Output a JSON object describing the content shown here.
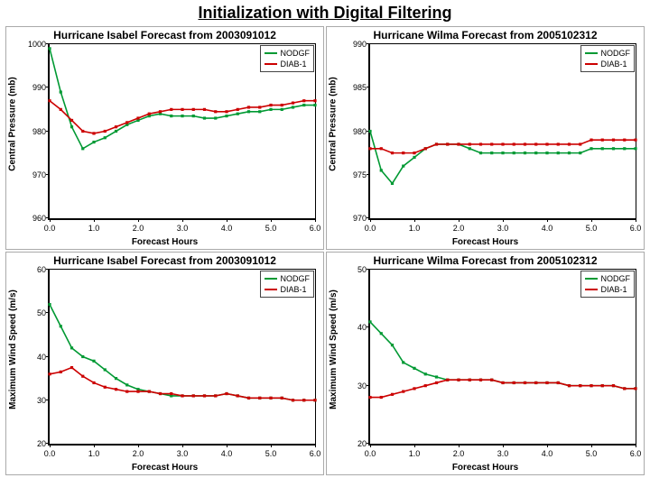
{
  "page_title": "Initialization with Digital Filtering",
  "colors": {
    "nodgf": "#009933",
    "diab1": "#cc0000"
  },
  "legend": {
    "s1": "NODGF",
    "s2": "DIAB-1"
  },
  "charts": [
    {
      "title": "Hurricane Isabel Forecast from 2003091012",
      "xlabel": "Forecast Hours",
      "ylabel": "Central Pressure (mb)"
    },
    {
      "title": "Hurricane Wilma Forecast from 2005102312",
      "xlabel": "Forecast Hours",
      "ylabel": "Central Pressure (mb)"
    },
    {
      "title": "Hurricane Isabel Forecast from 2003091012",
      "xlabel": "Forecast Hours",
      "ylabel": "Maximum Wind Speed (m/s)"
    },
    {
      "title": "Hurricane Wilma Forecast from 2005102312",
      "xlabel": "Forecast Hours",
      "ylabel": "Maximum Wind Speed (m/s)"
    }
  ],
  "chart_data": [
    {
      "type": "line",
      "title": "Hurricane Isabel Forecast from 2003091012",
      "xlabel": "Forecast Hours",
      "ylabel": "Central Pressure (mb)",
      "xlim": [
        0,
        6
      ],
      "ylim": [
        960,
        1000
      ],
      "xticks": [
        0,
        1,
        2,
        3,
        4,
        5,
        6
      ],
      "yticks": [
        960,
        970,
        980,
        990,
        1000
      ],
      "legend_pos": "top-right",
      "x": [
        0.0,
        0.25,
        0.5,
        0.75,
        1.0,
        1.25,
        1.5,
        1.75,
        2.0,
        2.25,
        2.5,
        2.75,
        3.0,
        3.25,
        3.5,
        3.75,
        4.0,
        4.25,
        4.5,
        4.75,
        5.0,
        5.25,
        5.5,
        5.75,
        6.0
      ],
      "series": [
        {
          "name": "NODGF",
          "color": "#009933",
          "values": [
            999,
            989,
            981,
            976,
            977.5,
            978.5,
            980,
            981.5,
            982.5,
            983.5,
            984,
            983.5,
            983.5,
            983.5,
            983,
            983,
            983.5,
            984,
            984.5,
            984.5,
            985,
            985,
            985.5,
            986,
            986
          ]
        },
        {
          "name": "DIAB-1",
          "color": "#cc0000",
          "values": [
            987,
            985,
            982.5,
            980,
            979.5,
            980,
            981,
            982,
            983,
            984,
            984.5,
            985,
            985,
            985,
            985,
            984.5,
            984.5,
            985,
            985.5,
            985.5,
            986,
            986,
            986.5,
            987,
            987
          ]
        }
      ]
    },
    {
      "type": "line",
      "title": "Hurricane Wilma Forecast from 2005102312",
      "xlabel": "Forecast Hours",
      "ylabel": "Central Pressure (mb)",
      "xlim": [
        0,
        6
      ],
      "ylim": [
        970,
        990
      ],
      "xticks": [
        0,
        1,
        2,
        3,
        4,
        5,
        6
      ],
      "yticks": [
        970,
        975,
        980,
        985,
        990
      ],
      "legend_pos": "top-right",
      "x": [
        0.0,
        0.25,
        0.5,
        0.75,
        1.0,
        1.25,
        1.5,
        1.75,
        2.0,
        2.25,
        2.5,
        2.75,
        3.0,
        3.25,
        3.5,
        3.75,
        4.0,
        4.25,
        4.5,
        4.75,
        5.0,
        5.25,
        5.5,
        5.75,
        6.0
      ],
      "series": [
        {
          "name": "NODGF",
          "color": "#009933",
          "values": [
            980,
            975.5,
            974,
            976,
            977,
            978,
            978.5,
            978.5,
            978.5,
            978,
            977.5,
            977.5,
            977.5,
            977.5,
            977.5,
            977.5,
            977.5,
            977.5,
            977.5,
            977.5,
            978,
            978,
            978,
            978,
            978
          ]
        },
        {
          "name": "DIAB-1",
          "color": "#cc0000",
          "values": [
            978,
            978,
            977.5,
            977.5,
            977.5,
            978,
            978.5,
            978.5,
            978.5,
            978.5,
            978.5,
            978.5,
            978.5,
            978.5,
            978.5,
            978.5,
            978.5,
            978.5,
            978.5,
            978.5,
            979,
            979,
            979,
            979,
            979
          ]
        }
      ]
    },
    {
      "type": "line",
      "title": "Hurricane Isabel Forecast from 2003091012",
      "xlabel": "Forecast Hours",
      "ylabel": "Maximum Wind Speed (m/s)",
      "xlim": [
        0,
        6
      ],
      "ylim": [
        20,
        60
      ],
      "xticks": [
        0,
        1,
        2,
        3,
        4,
        5,
        6
      ],
      "yticks": [
        20,
        30,
        40,
        50,
        60
      ],
      "legend_pos": "top-right",
      "x": [
        0.0,
        0.25,
        0.5,
        0.75,
        1.0,
        1.25,
        1.5,
        1.75,
        2.0,
        2.25,
        2.5,
        2.75,
        3.0,
        3.25,
        3.5,
        3.75,
        4.0,
        4.25,
        4.5,
        4.75,
        5.0,
        5.25,
        5.5,
        5.75,
        6.0
      ],
      "series": [
        {
          "name": "NODGF",
          "color": "#009933",
          "values": [
            52,
            47,
            42,
            40,
            39,
            37,
            35,
            33.5,
            32.5,
            32,
            31.5,
            31,
            31,
            31,
            31,
            31,
            31.5,
            31,
            30.5,
            30.5,
            30.5,
            30.5,
            30,
            30,
            30
          ]
        },
        {
          "name": "DIAB-1",
          "color": "#cc0000",
          "values": [
            36,
            36.5,
            37.5,
            35.5,
            34,
            33,
            32.5,
            32,
            32,
            32,
            31.5,
            31.5,
            31,
            31,
            31,
            31,
            31.5,
            31,
            30.5,
            30.5,
            30.5,
            30.5,
            30,
            30,
            30
          ]
        }
      ]
    },
    {
      "type": "line",
      "title": "Hurricane Wilma Forecast from 2005102312",
      "xlabel": "Forecast Hours",
      "ylabel": "Maximum Wind Speed (m/s)",
      "xlim": [
        0,
        6
      ],
      "ylim": [
        20,
        50
      ],
      "xticks": [
        0,
        1,
        2,
        3,
        4,
        5,
        6
      ],
      "yticks": [
        20,
        30,
        40,
        50
      ],
      "legend_pos": "top-right",
      "x": [
        0.0,
        0.25,
        0.5,
        0.75,
        1.0,
        1.25,
        1.5,
        1.75,
        2.0,
        2.25,
        2.5,
        2.75,
        3.0,
        3.25,
        3.5,
        3.75,
        4.0,
        4.25,
        4.5,
        4.75,
        5.0,
        5.25,
        5.5,
        5.75,
        6.0
      ],
      "series": [
        {
          "name": "NODGF",
          "color": "#009933",
          "values": [
            41,
            39,
            37,
            34,
            33,
            32,
            31.5,
            31,
            31,
            31,
            31,
            31,
            30.5,
            30.5,
            30.5,
            30.5,
            30.5,
            30.5,
            30,
            30,
            30,
            30,
            30,
            29.5,
            29.5
          ]
        },
        {
          "name": "DIAB-1",
          "color": "#cc0000",
          "values": [
            28,
            28,
            28.5,
            29,
            29.5,
            30,
            30.5,
            31,
            31,
            31,
            31,
            31,
            30.5,
            30.5,
            30.5,
            30.5,
            30.5,
            30.5,
            30,
            30,
            30,
            30,
            30,
            29.5,
            29.5
          ]
        }
      ]
    }
  ]
}
